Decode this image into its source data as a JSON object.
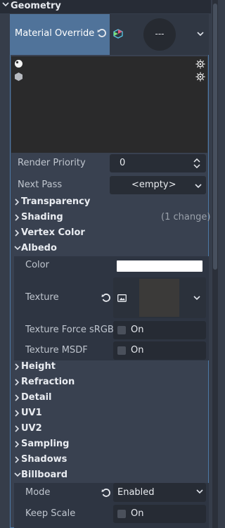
{
  "header": {
    "title": "Geometry"
  },
  "material_override": {
    "label": "Material Override",
    "value": "---"
  },
  "render_priority": {
    "label": "Render Priority",
    "value": "0"
  },
  "next_pass": {
    "label": "Next Pass",
    "value": "<empty>"
  },
  "sections": {
    "transparency": "Transparency",
    "shading": "Shading",
    "shading_changes": "(1 change)",
    "vertex_color": "Vertex Color",
    "albedo": "Albedo",
    "height": "Height",
    "refraction": "Refraction",
    "detail": "Detail",
    "uv1": "UV1",
    "uv2": "UV2",
    "sampling": "Sampling",
    "shadows": "Shadows",
    "billboard": "Billboard"
  },
  "albedo": {
    "color_label": "Color",
    "color_value": "#ffffff",
    "texture_label": "Texture",
    "force_srgb_label": "Texture Force sRGB",
    "force_srgb_value": "On",
    "msdf_label": "Texture MSDF",
    "msdf_value": "On"
  },
  "billboard": {
    "mode_label": "Mode",
    "mode_value": "Enabled",
    "keep_scale_label": "Keep Scale",
    "keep_scale_value": "On"
  },
  "colors": {
    "accent": "#50739a",
    "panel": "#363d4a",
    "field": "#282d36"
  }
}
